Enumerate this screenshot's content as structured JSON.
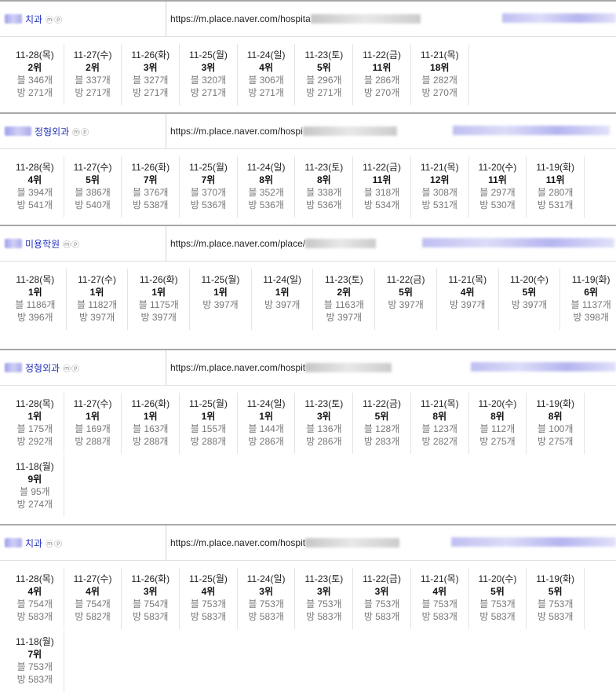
{
  "sections": [
    {
      "name": "치과",
      "icons": "ⓜⓟ",
      "url": "https://m.place.naver.com/hospita",
      "days": [
        {
          "date": "11-28(목)",
          "rank": "2위",
          "blog": "블 346개",
          "place": "방 271개"
        },
        {
          "date": "11-27(수)",
          "rank": "2위",
          "blog": "블 337개",
          "place": "방 271개"
        },
        {
          "date": "11-26(화)",
          "rank": "3위",
          "blog": "블 327개",
          "place": "방 271개"
        },
        {
          "date": "11-25(월)",
          "rank": "3위",
          "blog": "블 320개",
          "place": "방 271개"
        },
        {
          "date": "11-24(일)",
          "rank": "4위",
          "blog": "블 306개",
          "place": "방 271개"
        },
        {
          "date": "11-23(토)",
          "rank": "5위",
          "blog": "블 296개",
          "place": "방 271개"
        },
        {
          "date": "11-22(금)",
          "rank": "11위",
          "blog": "블 286개",
          "place": "방 270개"
        },
        {
          "date": "11-21(목)",
          "rank": "18위",
          "blog": "블 282개",
          "place": "방 270개"
        }
      ]
    },
    {
      "name": "정형외과",
      "icons": "ⓜⓟ",
      "url": "https://m.place.naver.com/hospi",
      "days": [
        {
          "date": "11-28(목)",
          "rank": "4위",
          "blog": "블 394개",
          "place": "방 541개"
        },
        {
          "date": "11-27(수)",
          "rank": "5위",
          "blog": "블 386개",
          "place": "방 540개"
        },
        {
          "date": "11-26(화)",
          "rank": "7위",
          "blog": "블 376개",
          "place": "방 538개"
        },
        {
          "date": "11-25(월)",
          "rank": "7위",
          "blog": "블 370개",
          "place": "방 536개"
        },
        {
          "date": "11-24(일)",
          "rank": "8위",
          "blog": "블 352개",
          "place": "방 536개"
        },
        {
          "date": "11-23(토)",
          "rank": "8위",
          "blog": "블 338개",
          "place": "방 536개"
        },
        {
          "date": "11-22(금)",
          "rank": "11위",
          "blog": "블 318개",
          "place": "방 534개"
        },
        {
          "date": "11-21(목)",
          "rank": "12위",
          "blog": "블 308개",
          "place": "방 531개"
        },
        {
          "date": "11-20(수)",
          "rank": "11위",
          "blog": "블 297개",
          "place": "방 530개"
        },
        {
          "date": "11-19(화)",
          "rank": "11위",
          "blog": "블 280개",
          "place": "방 531개"
        }
      ]
    },
    {
      "name": "미용학원",
      "icons": "ⓜⓟ",
      "url": "https://m.place.naver.com/place/",
      "days": [
        {
          "date": "11-28(목)",
          "rank": "1위",
          "blog": "블 1186개",
          "place": "방 396개"
        },
        {
          "date": "11-27(수)",
          "rank": "1위",
          "blog": "블 1182개",
          "place": "방 397개"
        },
        {
          "date": "11-26(화)",
          "rank": "1위",
          "blog": "블 1175개",
          "place": "방 397개"
        },
        {
          "date": "11-25(월)",
          "rank": "1위",
          "blog": "방 397개",
          "place": ""
        },
        {
          "date": "11-24(일)",
          "rank": "1위",
          "blog": "방 397개",
          "place": ""
        },
        {
          "date": "11-23(토)",
          "rank": "2위",
          "blog": "블 1163개",
          "place": "방 397개"
        },
        {
          "date": "11-22(금)",
          "rank": "5위",
          "blog": "방 397개",
          "place": ""
        },
        {
          "date": "11-21(목)",
          "rank": "4위",
          "blog": "방 397개",
          "place": ""
        },
        {
          "date": "11-20(수)",
          "rank": "5위",
          "blog": "방 397개",
          "place": ""
        },
        {
          "date": "11-19(화)",
          "rank": "6위",
          "blog": "블 1137개",
          "place": "방 398개"
        }
      ]
    },
    {
      "name": "정형외과",
      "icons": "ⓜⓟ",
      "url": "https://m.place.naver.com/hospit",
      "days": [
        {
          "date": "11-28(목)",
          "rank": "1위",
          "blog": "블 175개",
          "place": "방 292개"
        },
        {
          "date": "11-27(수)",
          "rank": "1위",
          "blog": "블 169개",
          "place": "방 288개"
        },
        {
          "date": "11-26(화)",
          "rank": "1위",
          "blog": "블 163개",
          "place": "방 288개"
        },
        {
          "date": "11-25(월)",
          "rank": "1위",
          "blog": "블 155개",
          "place": "방 288개"
        },
        {
          "date": "11-24(일)",
          "rank": "1위",
          "blog": "블 144개",
          "place": "방 286개"
        },
        {
          "date": "11-23(토)",
          "rank": "3위",
          "blog": "블 136개",
          "place": "방 286개"
        },
        {
          "date": "11-22(금)",
          "rank": "5위",
          "blog": "블 128개",
          "place": "방 283개"
        },
        {
          "date": "11-21(목)",
          "rank": "8위",
          "blog": "블 123개",
          "place": "방 282개"
        },
        {
          "date": "11-20(수)",
          "rank": "8위",
          "blog": "블 112개",
          "place": "방 275개"
        },
        {
          "date": "11-19(화)",
          "rank": "8위",
          "blog": "블 100개",
          "place": "방 275개"
        },
        {
          "date": "11-18(월)",
          "rank": "9위",
          "blog": "블 95개",
          "place": "방 274개"
        }
      ]
    },
    {
      "name": "치과",
      "icons": "ⓜⓟ",
      "url": "https://m.place.naver.com/hospit",
      "days": [
        {
          "date": "11-28(목)",
          "rank": "4위",
          "blog": "블 754개",
          "place": "방 583개"
        },
        {
          "date": "11-27(수)",
          "rank": "4위",
          "blog": "블 754개",
          "place": "방 582개"
        },
        {
          "date": "11-26(화)",
          "rank": "3위",
          "blog": "블 754개",
          "place": "방 583개"
        },
        {
          "date": "11-25(월)",
          "rank": "4위",
          "blog": "블 753개",
          "place": "방 583개"
        },
        {
          "date": "11-24(일)",
          "rank": "3위",
          "blog": "블 753개",
          "place": "방 583개"
        },
        {
          "date": "11-23(토)",
          "rank": "3위",
          "blog": "블 753개",
          "place": "방 583개"
        },
        {
          "date": "11-22(금)",
          "rank": "3위",
          "blog": "블 753개",
          "place": "방 583개"
        },
        {
          "date": "11-21(목)",
          "rank": "4위",
          "blog": "블 753개",
          "place": "방 583개"
        },
        {
          "date": "11-20(수)",
          "rank": "5위",
          "blog": "블 753개",
          "place": "방 583개"
        },
        {
          "date": "11-19(화)",
          "rank": "5위",
          "blog": "블 753개",
          "place": "방 583개"
        },
        {
          "date": "11-18(월)",
          "rank": "7위",
          "blog": "블 753개",
          "place": "방 583개"
        }
      ]
    }
  ]
}
